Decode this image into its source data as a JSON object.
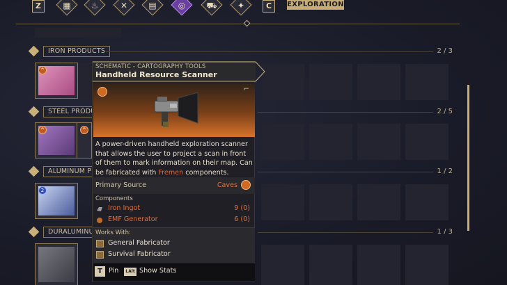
{
  "topbar": {
    "left_key": "Z",
    "right_key": "C",
    "mode_label": "EXPLORATION",
    "tabs": [
      {
        "icon": "grid-icon",
        "glyph": "▦",
        "active": false
      },
      {
        "icon": "flame-icon",
        "glyph": "♨",
        "active": false
      },
      {
        "icon": "crossed-tools-icon",
        "glyph": "✕",
        "active": false
      },
      {
        "icon": "bricks-icon",
        "glyph": "▤",
        "active": false
      },
      {
        "icon": "compass-icon",
        "glyph": "◎",
        "active": true
      },
      {
        "icon": "vehicle-icon",
        "glyph": "⛟",
        "active": false
      },
      {
        "icon": "star-icon",
        "glyph": "✦",
        "active": false
      }
    ]
  },
  "categories": [
    {
      "label": "IRON PRODUCTS",
      "count": "2 / 3"
    },
    {
      "label": "STEEL PRODU",
      "count": "2 / 5"
    },
    {
      "label": "ALUMINUM PI",
      "count": "1 / 2"
    },
    {
      "label": "DURALUMINU",
      "count": "1 / 3"
    }
  ],
  "tooltip": {
    "kind": "SCHEMATIC - CARTOGRAPHY TOOLS",
    "title": "Handheld Resource Scanner",
    "description_pre": "A power-driven handheld exploration scanner that allows the user to project a scan in front of them to mark information on their map. Can be fabricated with ",
    "description_highlight": "Fremen",
    "description_post": " components.",
    "primary_source_label": "Primary Source",
    "primary_source_value": "Caves",
    "components_label": "Components",
    "components": [
      {
        "name": "Iron Ingot",
        "qty": "9 (0)",
        "icon": "ingot-icon"
      },
      {
        "name": "EMF Generator",
        "qty": "6 (0)",
        "icon": "generator-icon"
      }
    ],
    "works_with_label": "Works With:",
    "works_with": [
      {
        "name": "General Fabricator",
        "icon": "fabricator-icon"
      },
      {
        "name": "Survival Fabricator",
        "icon": "fabricator-icon"
      }
    ],
    "footer": {
      "pin_key": "T",
      "pin_label": "Pin",
      "stats_key": "LAlt",
      "stats_label": "Show Stats"
    }
  },
  "colors": {
    "accent_gold": "#c9b07a",
    "highlight_orange": "#e06f3a",
    "active_tab": "#6a3fa0"
  }
}
